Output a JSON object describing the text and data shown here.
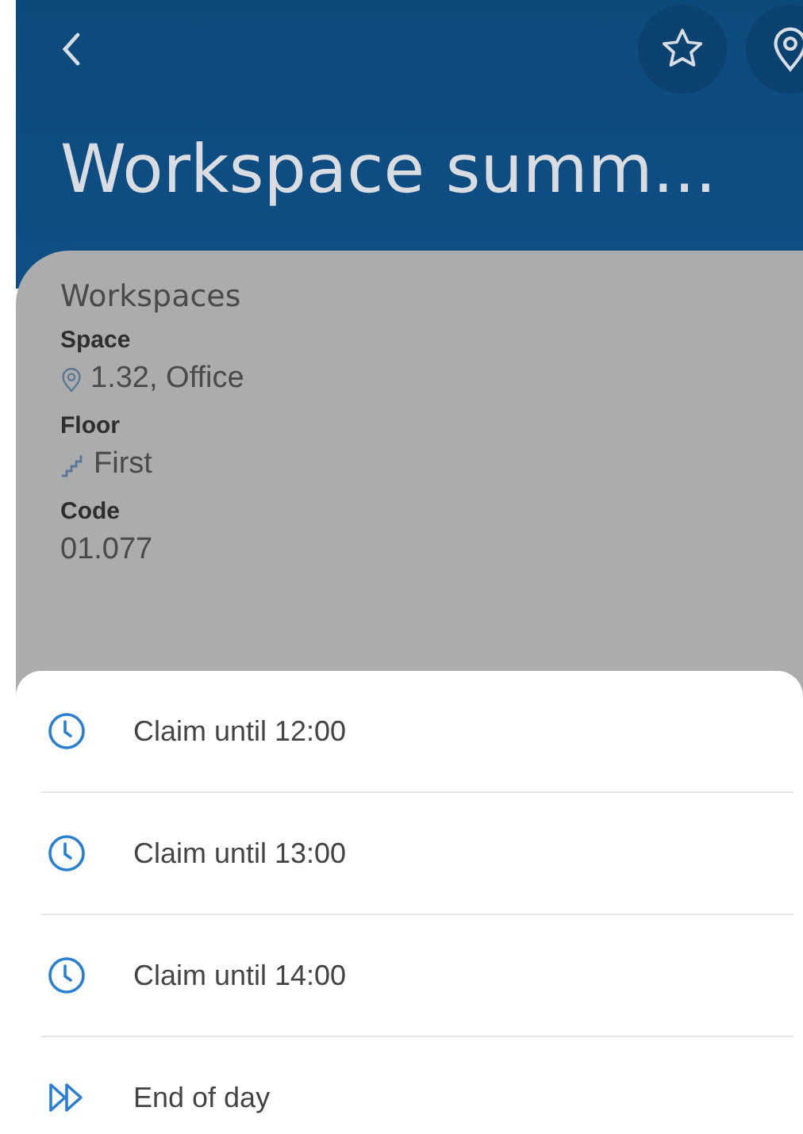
{
  "header": {
    "title": "Workspace summ..."
  },
  "details": {
    "heading": "Workspaces",
    "fields": [
      {
        "label": "Space",
        "value": "1.32, Office",
        "kind": "location"
      },
      {
        "label": "Floor",
        "value": "First",
        "kind": "stairs"
      },
      {
        "label": "Code",
        "value": "01.077",
        "kind": "plain"
      }
    ]
  },
  "claim_options": [
    {
      "label": "Claim until 12:00",
      "kind": "clock"
    },
    {
      "label": "Claim until 13:00",
      "kind": "clock"
    },
    {
      "label": "Claim until 14:00",
      "kind": "clock"
    },
    {
      "label": "End of day",
      "kind": "fast-forward"
    }
  ]
}
